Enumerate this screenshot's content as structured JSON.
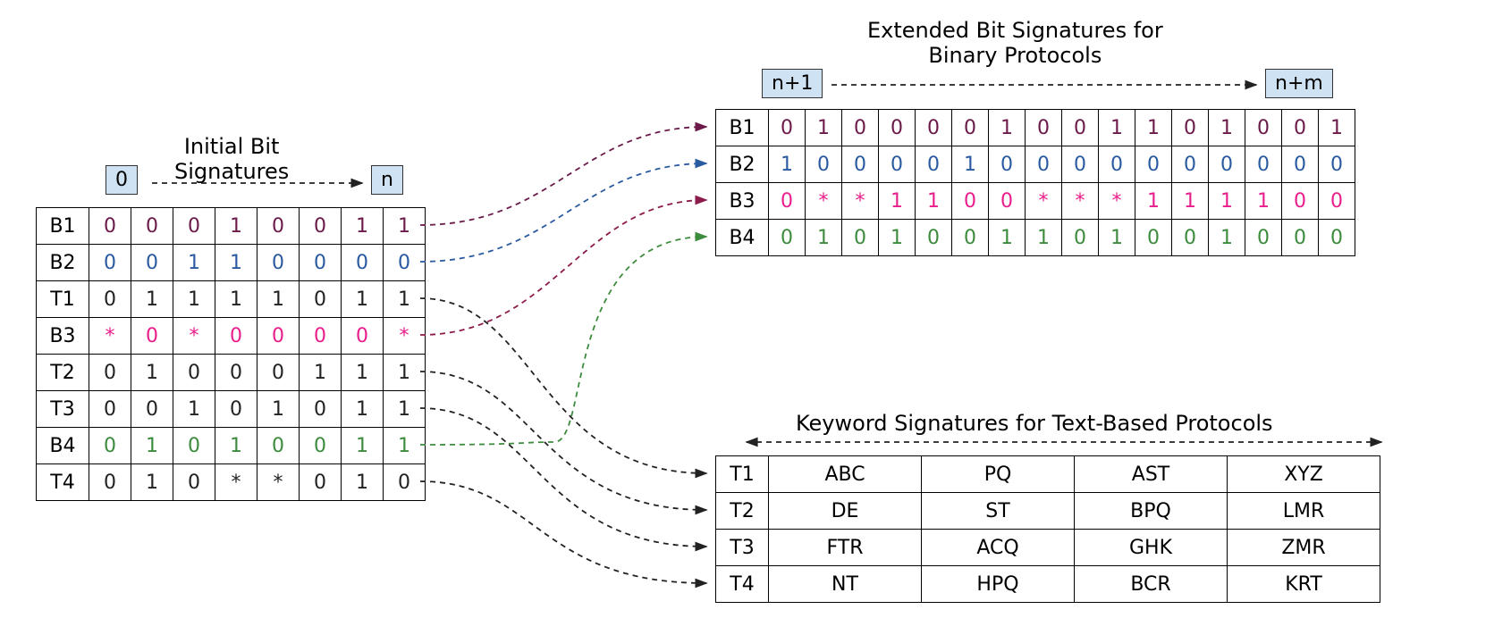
{
  "titles": {
    "initial": "Initial Bit\nSignatures",
    "extended": "Extended Bit Signatures for\nBinary Protocols",
    "keyword": "Keyword Signatures for Text-Based Protocols"
  },
  "labels": {
    "zero": "0",
    "n": "n",
    "nplus1": "n+1",
    "nplusm": "n+m"
  },
  "initial": {
    "rows": [
      {
        "id": "B1",
        "cls": "c-b1",
        "bits": [
          "0",
          "0",
          "0",
          "1",
          "0",
          "0",
          "1",
          "1"
        ]
      },
      {
        "id": "B2",
        "cls": "c-b2",
        "bits": [
          "0",
          "0",
          "1",
          "1",
          "0",
          "0",
          "0",
          "0"
        ]
      },
      {
        "id": "T1",
        "cls": "c-t",
        "bits": [
          "0",
          "1",
          "1",
          "1",
          "1",
          "0",
          "1",
          "1"
        ]
      },
      {
        "id": "B3",
        "cls": "c-b3",
        "bits": [
          "*",
          "0",
          "*",
          "0",
          "0",
          "0",
          "0",
          "*"
        ]
      },
      {
        "id": "T2",
        "cls": "c-t",
        "bits": [
          "0",
          "1",
          "0",
          "0",
          "0",
          "1",
          "1",
          "1"
        ]
      },
      {
        "id": "T3",
        "cls": "c-t",
        "bits": [
          "0",
          "0",
          "1",
          "0",
          "1",
          "0",
          "1",
          "1"
        ]
      },
      {
        "id": "B4",
        "cls": "c-b4",
        "bits": [
          "0",
          "1",
          "0",
          "1",
          "0",
          "0",
          "1",
          "1"
        ]
      },
      {
        "id": "T4",
        "cls": "c-t",
        "bits": [
          "0",
          "1",
          "0",
          "*",
          "*",
          "0",
          "1",
          "0"
        ]
      }
    ]
  },
  "extended": {
    "rows": [
      {
        "id": "B1",
        "cls": "c-b1",
        "bits": [
          "0",
          "1",
          "0",
          "0",
          "0",
          "0",
          "1",
          "0",
          "0",
          "1",
          "1",
          "0",
          "1",
          "0",
          "0",
          "1"
        ]
      },
      {
        "id": "B2",
        "cls": "c-b2",
        "bits": [
          "1",
          "0",
          "0",
          "0",
          "0",
          "1",
          "0",
          "0",
          "0",
          "0",
          "0",
          "0",
          "0",
          "0",
          "0",
          "0"
        ]
      },
      {
        "id": "B3",
        "cls": "c-b3",
        "bits": [
          "0",
          "*",
          "*",
          "1",
          "1",
          "0",
          "0",
          "*",
          "*",
          "*",
          "1",
          "1",
          "1",
          "1",
          "0",
          "0"
        ]
      },
      {
        "id": "B4",
        "cls": "c-b4",
        "bits": [
          "0",
          "1",
          "0",
          "1",
          "0",
          "0",
          "1",
          "1",
          "0",
          "1",
          "0",
          "0",
          "1",
          "0",
          "0",
          "0"
        ]
      }
    ]
  },
  "keyword": {
    "rows": [
      {
        "id": "T1",
        "words": [
          "ABC",
          "PQ",
          "AST",
          "XYZ"
        ]
      },
      {
        "id": "T2",
        "words": [
          "DE",
          "ST",
          "BPQ",
          "LMR"
        ]
      },
      {
        "id": "T3",
        "words": [
          "FTR",
          "ACQ",
          "GHK",
          "ZMR"
        ]
      },
      {
        "id": "T4",
        "words": [
          "NT",
          "HPQ",
          "BCR",
          "KRT"
        ]
      }
    ]
  }
}
